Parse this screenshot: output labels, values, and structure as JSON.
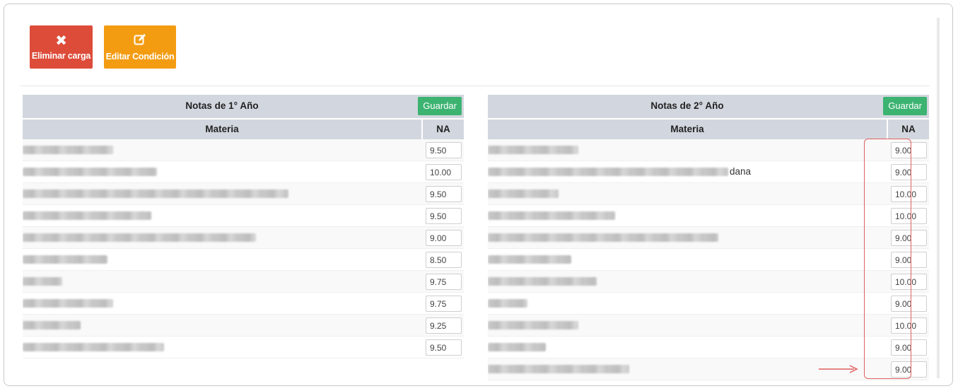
{
  "colors": {
    "danger": "#dd4b39",
    "warning": "#f39c12",
    "success": "#3cb371",
    "table_header": "#d2d6de",
    "highlight": "#e06060"
  },
  "actions": {
    "delete": {
      "label": "Eliminar carga",
      "icon": "close-icon"
    },
    "edit": {
      "label": "Editar Condición",
      "icon": "edit-icon"
    }
  },
  "year1": {
    "title": "Notas de 1° Año",
    "save_label": "Guardar",
    "col_subject": "Materia",
    "col_grade": "NA",
    "grades": [
      "9.50",
      "10.00",
      "9.50",
      "9.50",
      "9.00",
      "8.50",
      "9.75",
      "9.75",
      "9.25",
      "9.50"
    ]
  },
  "year2": {
    "title": "Notas de 2° Año",
    "save_label": "Guardar",
    "col_subject": "Materia",
    "col_grade": "NA",
    "visible_suffix": "dana",
    "grades": [
      "9.00",
      "9.00",
      "10.00",
      "10.00",
      "9.00",
      "9.00",
      "10.00",
      "9.00",
      "10.00",
      "9.00",
      "9.00"
    ]
  }
}
